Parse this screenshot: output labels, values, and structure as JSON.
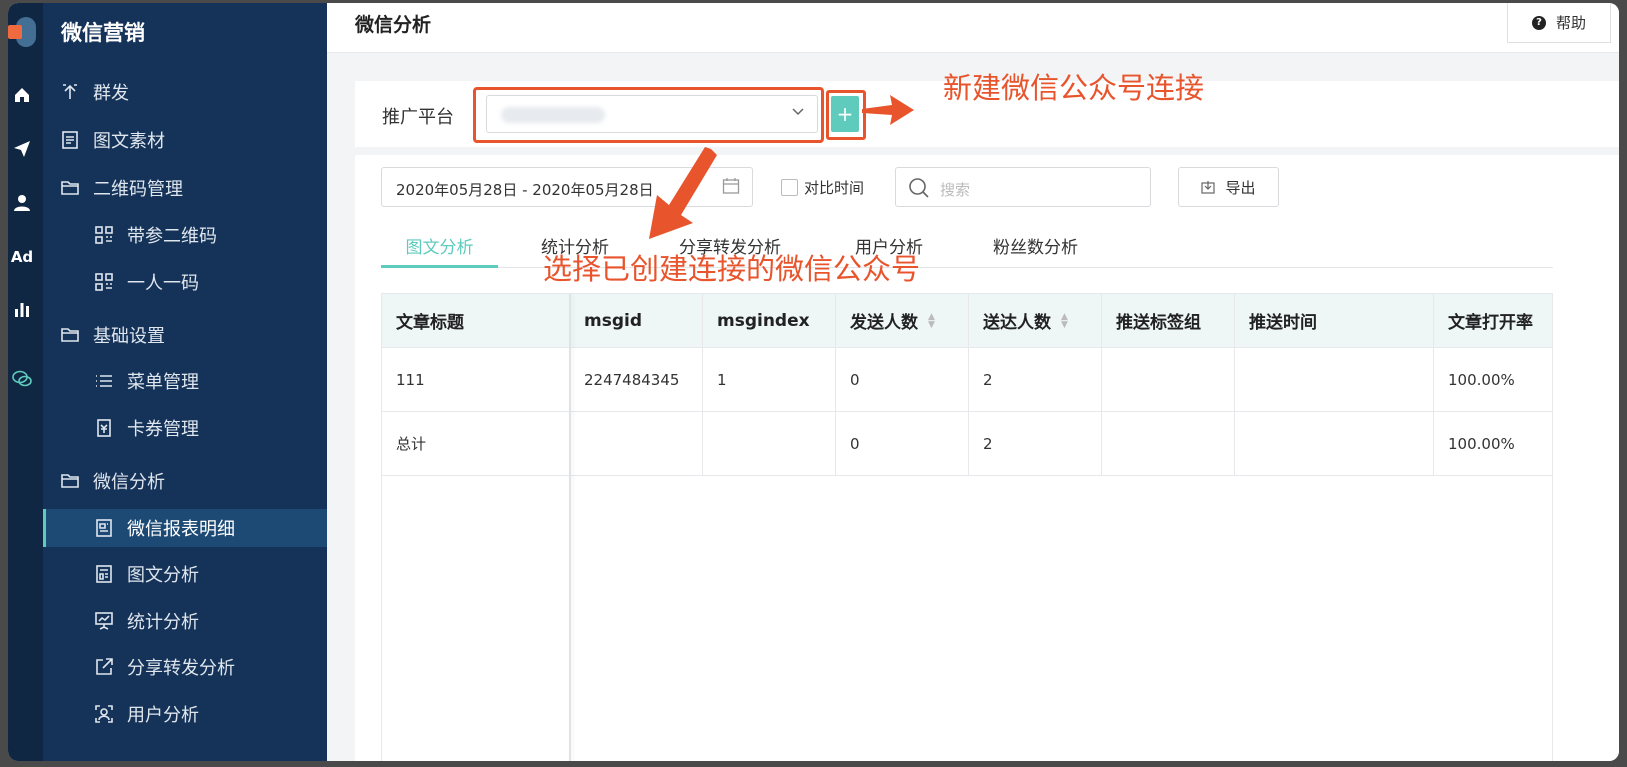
{
  "sidebar": {
    "title": "微信营销",
    "items": [
      {
        "label": "群发"
      },
      {
        "label": "图文素材"
      },
      {
        "label": "二维码管理"
      },
      {
        "label": "带参二维码"
      },
      {
        "label": "一人一码"
      },
      {
        "label": "基础设置"
      },
      {
        "label": "菜单管理"
      },
      {
        "label": "卡券管理"
      },
      {
        "label": "微信分析"
      },
      {
        "label": "微信报表明细"
      },
      {
        "label": "图文分析"
      },
      {
        "label": "统计分析"
      },
      {
        "label": "分享转发分析"
      },
      {
        "label": "用户分析"
      }
    ]
  },
  "rail": {
    "ad_label": "Ad"
  },
  "header": {
    "title": "微信分析",
    "help_label": "帮助"
  },
  "platform": {
    "label": "推广平台",
    "add_label": "+"
  },
  "toolbar": {
    "date_range": "2020年05月28日 - 2020年05月28日",
    "compare_label": "对比时间",
    "search_placeholder": "搜索",
    "export_label": "导出"
  },
  "tabs": [
    "图文分析",
    "统计分析",
    "分享转发分析",
    "用户分析",
    "粉丝数分析"
  ],
  "table": {
    "columns": [
      "文章标题",
      "msgid",
      "msgindex",
      "发送人数",
      "送达人数",
      "推送标签组",
      "推送时间",
      "文章打开率"
    ],
    "rows": [
      [
        "111",
        "2247484345",
        "1",
        "0",
        "2",
        "",
        "",
        "100.00%"
      ],
      [
        "总计",
        "",
        "",
        "0",
        "2",
        "",
        "",
        "100.00%"
      ]
    ]
  },
  "annotations": {
    "new_connection": "新建微信公众号连接",
    "select_connection": "选择已创建连接的微信公众号"
  },
  "colors": {
    "accent": "#5fcbbd",
    "sidebar": "#153358",
    "rail": "#0f2742",
    "annotation": "#e8542c"
  }
}
